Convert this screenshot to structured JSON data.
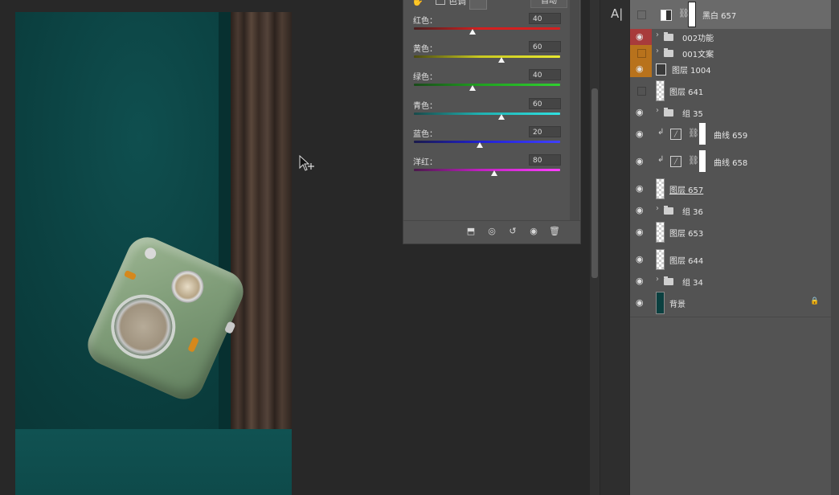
{
  "properties_panel": {
    "tint_label": "色调",
    "auto_label": "自动",
    "sliders": [
      {
        "label": "红色：",
        "value": "40",
        "level": 0.4,
        "gradient": [
          "#d42020",
          "#4a2020",
          "#d42020"
        ]
      },
      {
        "label": "黄色：",
        "value": "60",
        "level": 0.6,
        "gradient": [
          "#c8c820",
          "#4a4a10",
          "#e8e830"
        ]
      },
      {
        "label": "绿色：",
        "value": "40",
        "level": 0.4,
        "gradient": [
          "#20a020",
          "#1a4a1a",
          "#30d030"
        ]
      },
      {
        "label": "青色：",
        "value": "60",
        "level": 0.6,
        "gradient": [
          "#20b0b0",
          "#1a4a4a",
          "#30e0e0"
        ]
      },
      {
        "label": "蓝色：",
        "value": "20",
        "level": 0.45,
        "gradient": [
          "#2020d0",
          "#1a1a4a",
          "#4040ff"
        ]
      },
      {
        "label": "洋红：",
        "value": "80",
        "level": 0.55,
        "gradient": [
          "#c020c0",
          "#4a1a4a",
          "#ff40ff"
        ]
      }
    ],
    "footer_icons": [
      "clip-to-layer-icon",
      "view-previous-icon",
      "reset-icon",
      "visibility-icon",
      "delete-icon"
    ]
  },
  "layers_panel": {
    "layers": [
      {
        "name": "黑白 657",
        "kind": "adjustment",
        "visible": false,
        "selected": true
      },
      {
        "name": "002功能",
        "kind": "group",
        "visible": true,
        "label_color": "#a83b3b"
      },
      {
        "name": "001文案",
        "kind": "group",
        "visible": false,
        "label_color": "#b8721c"
      },
      {
        "name": "图层 1004",
        "kind": "smart",
        "visible": true,
        "label_color": "#b8721c"
      },
      {
        "name": "图层 641",
        "kind": "pixel",
        "visible": false
      },
      {
        "name": "组 35",
        "kind": "group",
        "visible": true
      },
      {
        "name": "曲线 659",
        "kind": "curves",
        "visible": true
      },
      {
        "name": "曲线 658",
        "kind": "curves",
        "visible": true
      },
      {
        "name": "图层 657",
        "kind": "pixel",
        "visible": true
      },
      {
        "name": "组 36",
        "kind": "group",
        "visible": true
      },
      {
        "name": "图层 653",
        "kind": "pixel",
        "visible": true
      },
      {
        "name": "图层 644",
        "kind": "pixel",
        "visible": true
      },
      {
        "name": "组 34",
        "kind": "group",
        "visible": true
      },
      {
        "name": "背景",
        "kind": "background",
        "visible": true,
        "locked": true
      }
    ]
  },
  "toolstrip": {
    "character_icon": "A|"
  },
  "colors": {
    "canvas_bg": "#282828",
    "panel_bg": "#535353",
    "wall": "#0b4040",
    "curtain": "#3a2d26"
  }
}
